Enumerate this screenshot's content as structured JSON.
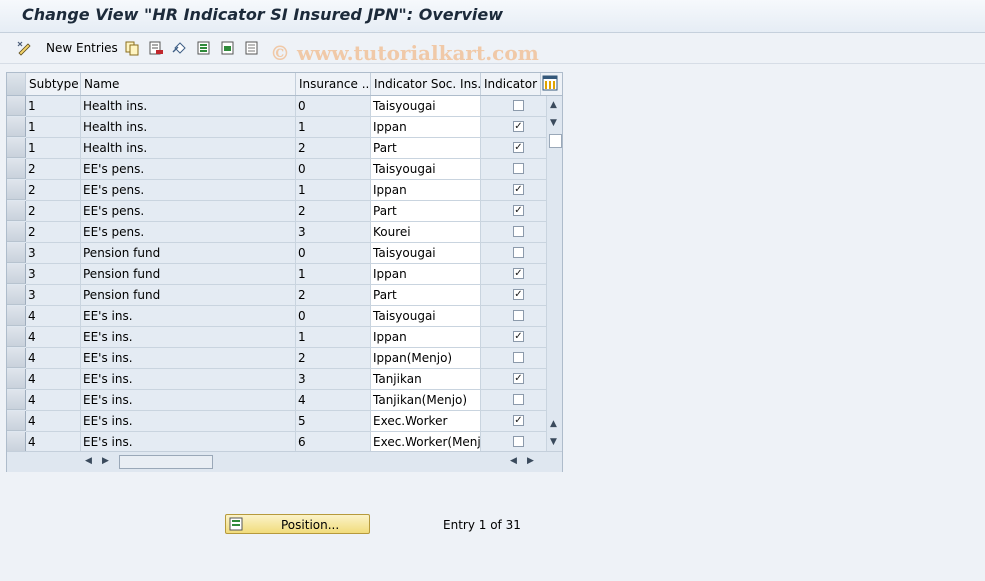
{
  "window": {
    "title": "Change View \"HR Indicator SI Insured JPN\": Overview"
  },
  "toolbar": {
    "new_entries_label": "New Entries",
    "icons": [
      "edit-toggle-icon",
      "copy-icon",
      "delete-icon",
      "undo-icon",
      "select-all-icon",
      "select-block-icon",
      "deselect-all-icon"
    ]
  },
  "watermark": "© www.tutorialkart.com",
  "table": {
    "headers": {
      "subtype": "Subtype",
      "name": "Name",
      "insurance": "Insurance ...",
      "indicator_soc": "Indicator Soc. Ins.",
      "indicator": "Indicator ..."
    },
    "rows": [
      {
        "subtype": "1",
        "name": "Health ins.",
        "insurance": "0",
        "indicator_soc": "Taisyougai",
        "checked": false
      },
      {
        "subtype": "1",
        "name": "Health ins.",
        "insurance": "1",
        "indicator_soc": "Ippan",
        "checked": true
      },
      {
        "subtype": "1",
        "name": "Health ins.",
        "insurance": "2",
        "indicator_soc": "Part",
        "checked": true
      },
      {
        "subtype": "2",
        "name": "EE's pens.",
        "insurance": "0",
        "indicator_soc": "Taisyougai",
        "checked": false
      },
      {
        "subtype": "2",
        "name": "EE's pens.",
        "insurance": "1",
        "indicator_soc": "Ippan",
        "checked": true
      },
      {
        "subtype": "2",
        "name": "EE's pens.",
        "insurance": "2",
        "indicator_soc": "Part",
        "checked": true
      },
      {
        "subtype": "2",
        "name": "EE's pens.",
        "insurance": "3",
        "indicator_soc": "Kourei",
        "checked": false
      },
      {
        "subtype": "3",
        "name": "Pension fund",
        "insurance": "0",
        "indicator_soc": "Taisyougai",
        "checked": false
      },
      {
        "subtype": "3",
        "name": "Pension fund",
        "insurance": "1",
        "indicator_soc": "Ippan",
        "checked": true
      },
      {
        "subtype": "3",
        "name": "Pension fund",
        "insurance": "2",
        "indicator_soc": "Part",
        "checked": true
      },
      {
        "subtype": "4",
        "name": "EE's ins.",
        "insurance": "0",
        "indicator_soc": "Taisyougai",
        "checked": false
      },
      {
        "subtype": "4",
        "name": "EE's ins.",
        "insurance": "1",
        "indicator_soc": "Ippan",
        "checked": true
      },
      {
        "subtype": "4",
        "name": "EE's ins.",
        "insurance": "2",
        "indicator_soc": "Ippan(Menjo)",
        "checked": false
      },
      {
        "subtype": "4",
        "name": "EE's ins.",
        "insurance": "3",
        "indicator_soc": "Tanjikan",
        "checked": true
      },
      {
        "subtype": "4",
        "name": "EE's ins.",
        "insurance": "4",
        "indicator_soc": "Tanjikan(Menjo)",
        "checked": false
      },
      {
        "subtype": "4",
        "name": "EE's ins.",
        "insurance": "5",
        "indicator_soc": "Exec.Worker",
        "checked": true
      },
      {
        "subtype": "4",
        "name": "EE's ins.",
        "insurance": "6",
        "indicator_soc": "Exec.Worker(Menj…",
        "checked": false
      }
    ]
  },
  "footer": {
    "position_button_label": "Position...",
    "entry_text": "Entry 1 of 31"
  },
  "colors": {
    "background": "#eef2f7",
    "readonly_cell": "#e4ebf3",
    "editable_cell": "#ffffff",
    "button_yellow": "#f1dc7c"
  }
}
